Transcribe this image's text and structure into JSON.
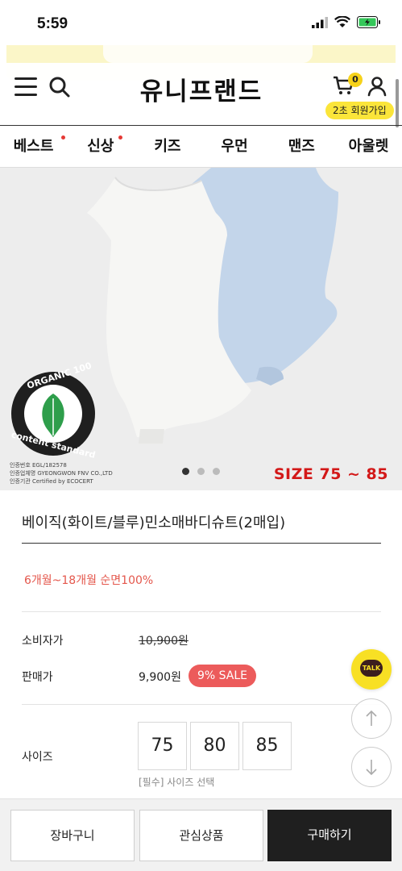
{
  "status_bar": {
    "time": "5:59"
  },
  "header": {
    "logo": "유니프랜드",
    "cart_count": "0",
    "join_label": "2초 회원가입"
  },
  "nav": {
    "items": [
      {
        "label": "베스트",
        "dot": true
      },
      {
        "label": "신상",
        "dot": true
      },
      {
        "label": "키즈",
        "dot": false
      },
      {
        "label": "우먼",
        "dot": false
      },
      {
        "label": "맨즈",
        "dot": false
      },
      {
        "label": "아울렛",
        "dot": false
      }
    ]
  },
  "hero": {
    "badge": {
      "arc_text": "ORGANIC 100",
      "bottom_text": "content standard"
    },
    "cert_lines": [
      "인증번호  EGL/182578",
      "인증업체명  GYEONGWON FNV CO.,LTD",
      "인증기관  Certified by ECOCERT"
    ],
    "size_text": "SIZE 75 ~ 85",
    "slide_count": 3,
    "active_slide": 0
  },
  "product": {
    "title": "베이직(화이트/블루)민소매바디슈트(2매입)",
    "subtitle": "6개월~18개월 순면100%",
    "list_price_label": "소비자가",
    "list_price": "10,900원",
    "sale_price_label": "판매가",
    "sale_price": "9,900원",
    "sale_badge": "9% SALE",
    "size_label": "사이즈",
    "sizes": [
      "75",
      "80",
      "85"
    ],
    "size_hint": "[필수] 사이즈 선택"
  },
  "floating": {
    "kakao_label": "TALK"
  },
  "bottom_bar": {
    "cart_button": "장바구니",
    "wishlist_button": "관심상품",
    "buy_button": "구매하기"
  },
  "colors": {
    "accent_yellow": "#fbe53a",
    "sale_red": "#ec5b5b",
    "subtitle_red": "#e4574c",
    "size_overlay_red": "#d31818",
    "buy_button_bg": "#1f1f1f"
  }
}
